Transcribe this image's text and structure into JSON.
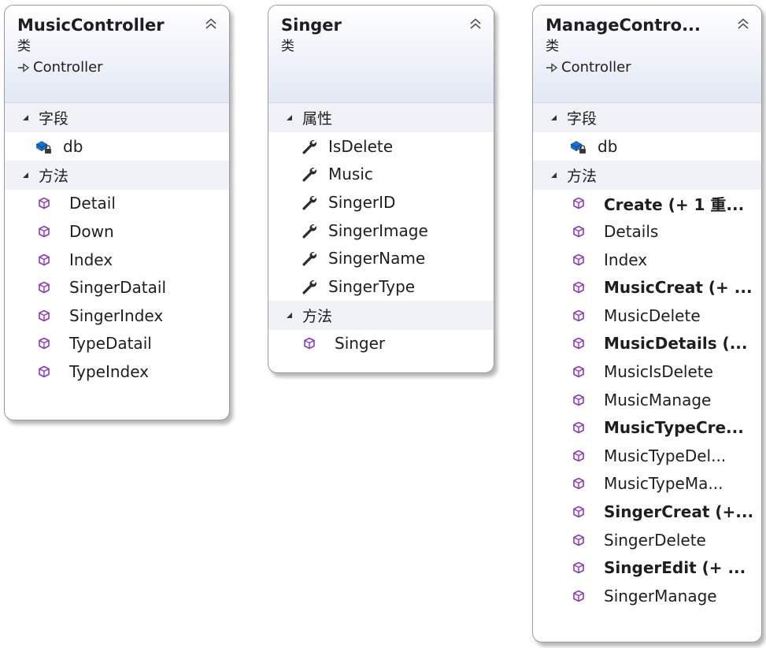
{
  "cards": [
    {
      "title": "MusicController",
      "stereotype": "类",
      "base": "Controller",
      "sections": [
        {
          "label": "字段",
          "type": "field",
          "members": [
            {
              "name": "db"
            }
          ]
        },
        {
          "label": "方法",
          "type": "method",
          "members": [
            {
              "name": "Detail"
            },
            {
              "name": "Down"
            },
            {
              "name": "Index"
            },
            {
              "name": "SingerDatail"
            },
            {
              "name": "SingerIndex"
            },
            {
              "name": "TypeDatail"
            },
            {
              "name": "TypeIndex"
            }
          ]
        }
      ]
    },
    {
      "title": "Singer",
      "stereotype": "类",
      "sections": [
        {
          "label": "属性",
          "type": "property",
          "members": [
            {
              "name": "IsDelete"
            },
            {
              "name": "Music"
            },
            {
              "name": "SingerID"
            },
            {
              "name": "SingerImage"
            },
            {
              "name": "SingerName"
            },
            {
              "name": "SingerType"
            }
          ]
        },
        {
          "label": "方法",
          "type": "method",
          "members": [
            {
              "name": "Singer"
            }
          ]
        }
      ]
    },
    {
      "title": "ManageContro...",
      "stereotype": "类",
      "base": "Controller",
      "sections": [
        {
          "label": "字段",
          "type": "field",
          "members": [
            {
              "name": "db"
            }
          ]
        },
        {
          "label": "方法",
          "type": "method",
          "members": [
            {
              "name": "Create (+ 1 重...",
              "bold": true
            },
            {
              "name": "Details"
            },
            {
              "name": "Index"
            },
            {
              "name": "MusicCreat (+ ...",
              "bold": true
            },
            {
              "name": "MusicDelete"
            },
            {
              "name": "MusicDetails (...",
              "bold": true
            },
            {
              "name": "MusicIsDelete"
            },
            {
              "name": "MusicManage"
            },
            {
              "name": "MusicTypeCre...",
              "bold": true
            },
            {
              "name": "MusicTypeDel..."
            },
            {
              "name": "MusicTypeMa..."
            },
            {
              "name": "SingerCreat (+...",
              "bold": true
            },
            {
              "name": "SingerDelete"
            },
            {
              "name": "SingerEdit (+ ...",
              "bold": true
            },
            {
              "name": "SingerManage"
            }
          ]
        }
      ]
    }
  ],
  "colors": {
    "method_icon": "#8a3ab9",
    "property_icon": "#2b2b2b",
    "field_icon": "#1e6fc8",
    "header_gradient_end": "#e2e8f4",
    "section_bg": "#f0f2f8"
  },
  "icons": {
    "field": "field-icon",
    "property": "wrench-icon",
    "method": "method-cube-icon",
    "collapse": "collapse-chevron-icon",
    "inherit": "inherits-arrow-icon"
  }
}
